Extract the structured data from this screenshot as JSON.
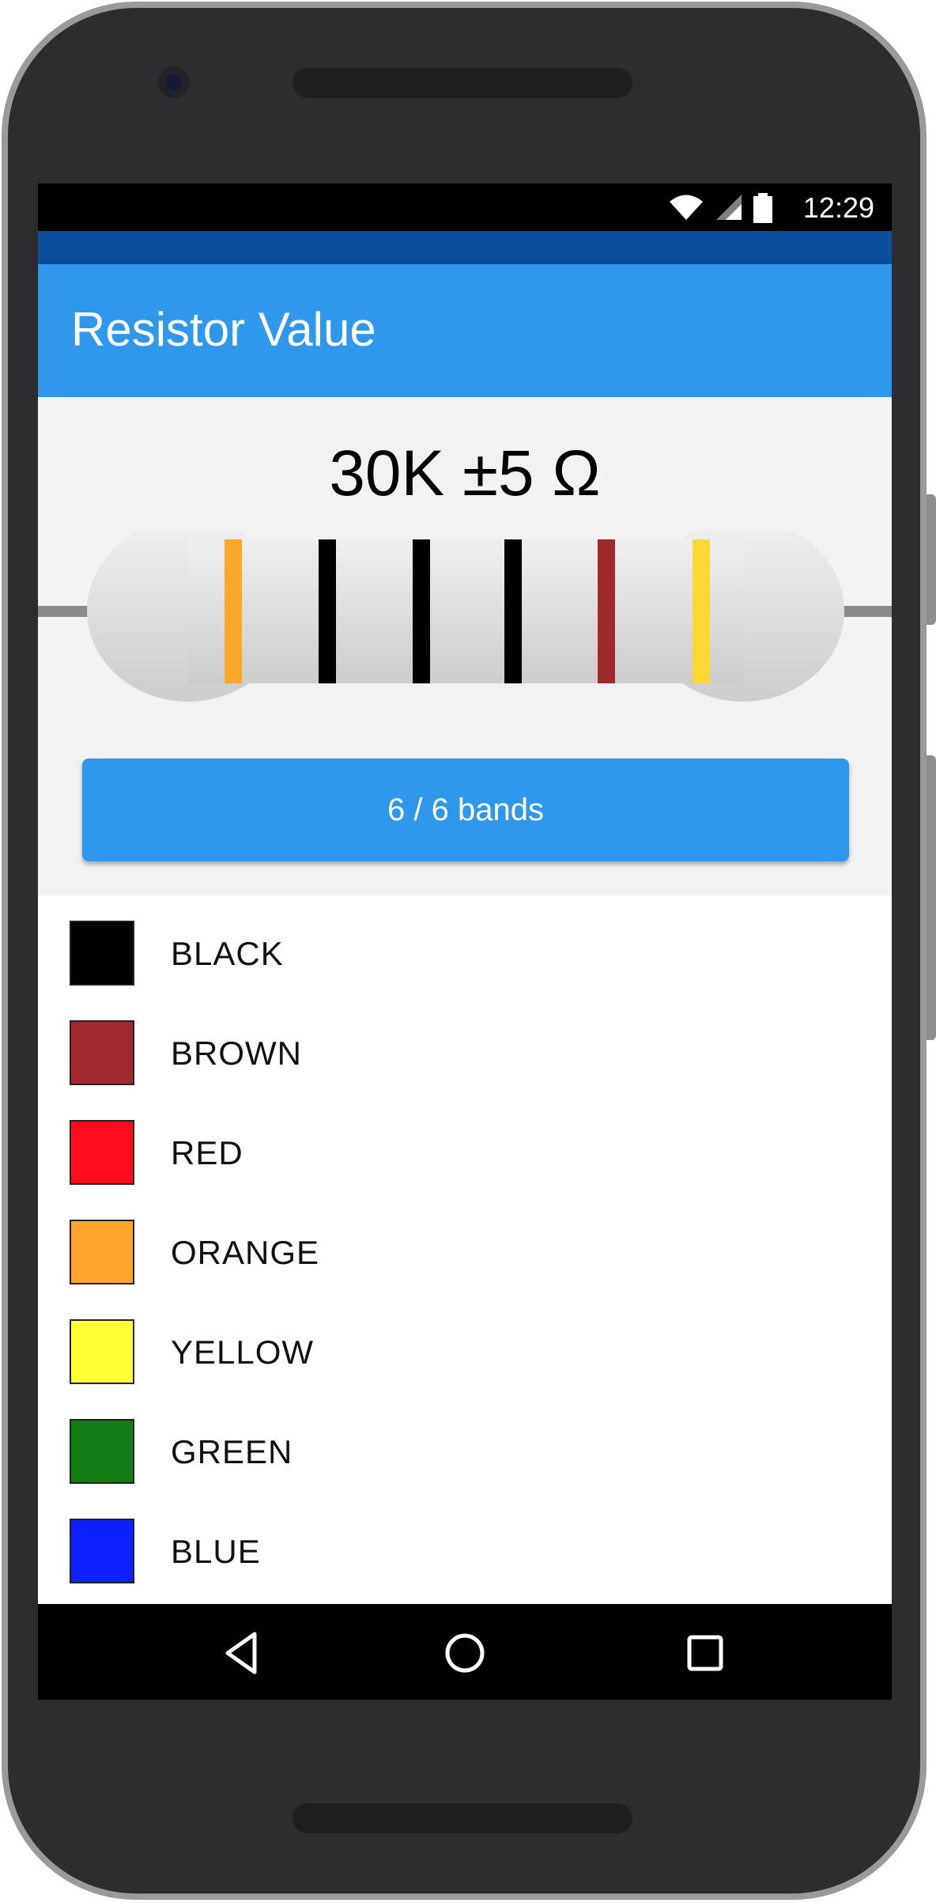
{
  "status": {
    "time": "12:29"
  },
  "app": {
    "title": "Resistor Value"
  },
  "resistor": {
    "value_text": "30K ±5 Ω",
    "bands": [
      {
        "color": "#f9a82b"
      },
      {
        "color": "#000000"
      },
      {
        "color": "#000000"
      },
      {
        "color": "#000000"
      },
      {
        "color": "#a02a2b"
      },
      {
        "color": "#fdd835"
      }
    ]
  },
  "bands_button": {
    "label": "6 / 6 bands"
  },
  "colors": [
    {
      "name": "BLACK",
      "hex": "#000000"
    },
    {
      "name": "BROWN",
      "hex": "#a02a2f"
    },
    {
      "name": "RED",
      "hex": "#ff0d1c"
    },
    {
      "name": "ORANGE",
      "hex": "#fca42c"
    },
    {
      "name": "YELLOW",
      "hex": "#ffff33"
    },
    {
      "name": "GREEN",
      "hex": "#117b14"
    },
    {
      "name": "BLUE",
      "hex": "#0c1fff"
    }
  ],
  "icons": {
    "status": [
      "wifi-icon",
      "signal-icon",
      "battery-icon"
    ],
    "nav": [
      "back-icon",
      "home-icon",
      "recents-icon"
    ]
  }
}
